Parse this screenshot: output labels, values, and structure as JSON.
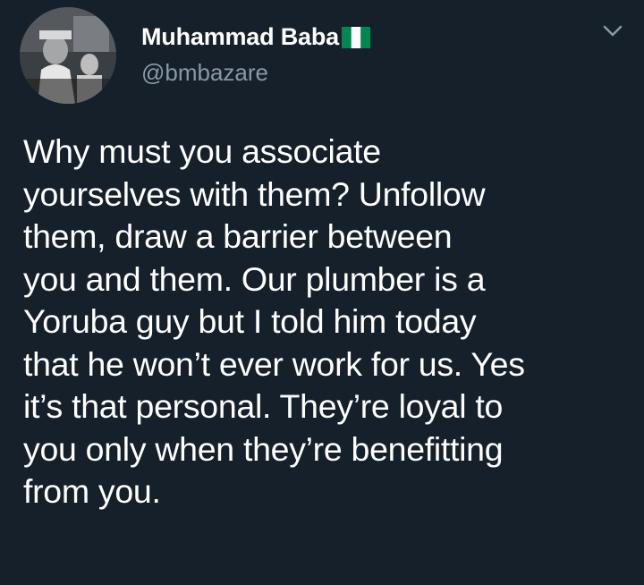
{
  "author": {
    "display_name": "Muhammad Baba",
    "handle": "@bmbazare",
    "flag": "nigeria-flag-icon"
  },
  "tweet": {
    "text": "Why must you associate\nyourselves with them? Unfollow\nthem, draw a barrier between\nyou and them. Our plumber is a\nYoruba guy but I told him today\nthat he won’t ever work for us. Yes\nit’s that personal. They’re loyal to\nyou only when they’re benefitting\nfrom you."
  },
  "icons": {
    "menu": "chevron-down-icon"
  },
  "colors": {
    "background": "#15202b",
    "primary_text": "#ffffff",
    "secondary_text": "#8899a6",
    "flag_green": "#008751"
  }
}
